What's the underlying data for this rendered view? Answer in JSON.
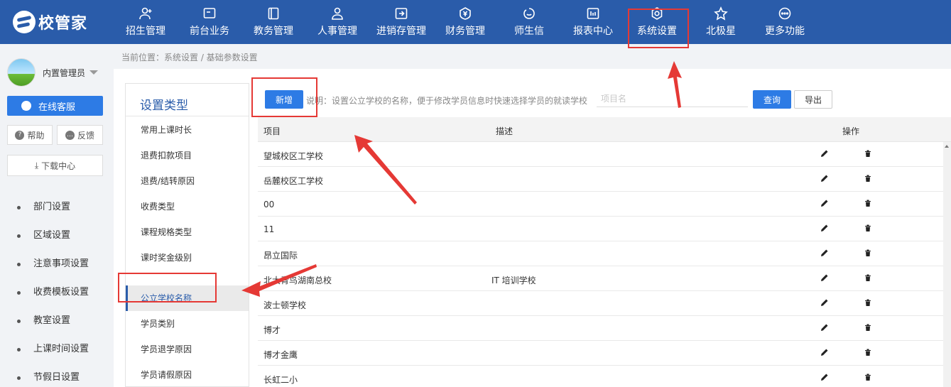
{
  "logo": {
    "text": "校管家"
  },
  "nav": [
    {
      "label": "招生管理",
      "icon": "user-add-icon"
    },
    {
      "label": "前台业务",
      "icon": "monitor-icon"
    },
    {
      "label": "教务管理",
      "icon": "book-icon"
    },
    {
      "label": "人事管理",
      "icon": "person-icon"
    },
    {
      "label": "进销存管理",
      "icon": "inventory-icon"
    },
    {
      "label": "财务管理",
      "icon": "yuan-shield-icon"
    },
    {
      "label": "师生信",
      "icon": "chat-bubble-icon"
    },
    {
      "label": "报表中心",
      "icon": "bar-chart-icon"
    },
    {
      "label": "系统设置",
      "icon": "gear-icon",
      "active": true
    },
    {
      "label": "北极星",
      "icon": "star-icon"
    },
    {
      "label": "更多功能",
      "icon": "more-icon"
    }
  ],
  "sidebar": {
    "user_name": "内置管理员",
    "service_label": "在线客服",
    "help_label": "帮助",
    "feedback_label": "反馈",
    "download_label": "下载中心",
    "menu": [
      "部门设置",
      "区域设置",
      "注意事项设置",
      "收费模板设置",
      "教室设置",
      "上课时间设置",
      "节假日设置"
    ]
  },
  "breadcrumb": "当前位置：系统设置 / 基础参数设置",
  "category": {
    "title": "设置类型",
    "items_top": [
      "常用上课时长",
      "退费扣款项目",
      "退费/结转原因",
      "收费类型",
      "课程规格类型",
      "课时奖金级别"
    ],
    "items_bottom": [
      "公立学校名称",
      "学员类别",
      "学员退学原因",
      "学员请假原因"
    ],
    "active": "公立学校名称"
  },
  "toolbar": {
    "add_label": "新增",
    "description": "说明：设置公立学校的名称，便于修改学员信息时快速选择学员的就读学校",
    "search_placeholder": "项目名",
    "query_label": "查询",
    "export_label": "导出"
  },
  "table": {
    "headers": {
      "item": "项目",
      "desc": "描述",
      "ops": "操作"
    },
    "rows": [
      {
        "item": "望城校区工学校",
        "desc": ""
      },
      {
        "item": "岳麓校区工学校",
        "desc": ""
      },
      {
        "item": "00",
        "desc": ""
      },
      {
        "item": "11",
        "desc": ""
      },
      {
        "item": "昂立国际",
        "desc": ""
      },
      {
        "item": "北大青鸟湖南总校",
        "desc": "IT 培训学校"
      },
      {
        "item": "波士顿学校",
        "desc": ""
      },
      {
        "item": "博才",
        "desc": ""
      },
      {
        "item": "博才金鹰",
        "desc": ""
      },
      {
        "item": "长虹二小",
        "desc": ""
      }
    ]
  },
  "colors": {
    "topbar": "#2a5caa",
    "primary": "#2d7be5",
    "annotation": "#e53935"
  }
}
